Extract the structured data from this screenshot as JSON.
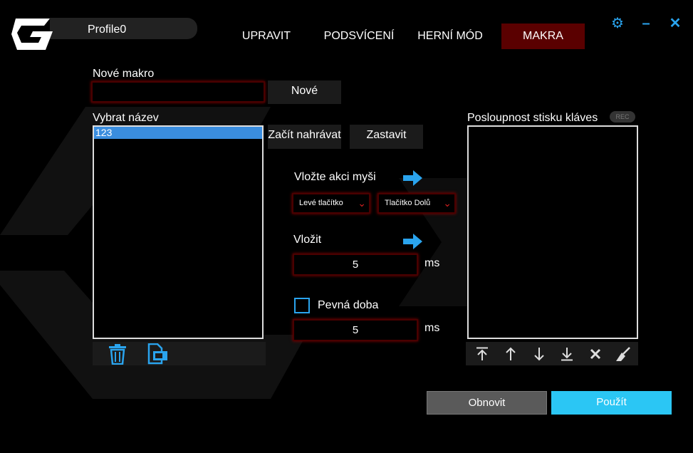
{
  "header": {
    "profile_name": "Profile0",
    "tabs": [
      {
        "label": "UPRAVIT",
        "active": false
      },
      {
        "label": "PODSVÍCENÍ",
        "active": false
      },
      {
        "label": "HERNÍ MÓD",
        "active": false
      },
      {
        "label": "MAKRA",
        "active": true
      }
    ],
    "window_controls": [
      "gear-icon",
      "minimize-icon",
      "close-icon"
    ]
  },
  "new_macro": {
    "label": "Nové makro",
    "input_value": "",
    "new_button": "Nové"
  },
  "macro_list": {
    "label": "Vybrat název",
    "items": [
      "123"
    ],
    "selected": "123",
    "toolbar_icons": [
      "trash-icon",
      "copy-icon"
    ]
  },
  "record": {
    "start_button": "Začít nahrávat",
    "stop_button": "Zastavit"
  },
  "mouse_action": {
    "label": "Vložte akci myši",
    "button_select": "Levé tlačítko",
    "direction_select": "Tlačítko Dolů"
  },
  "delay": {
    "label": "Vložit",
    "value": "5",
    "unit": "ms"
  },
  "fixed_time": {
    "label": "Pevná doba",
    "checked": false,
    "value": "5",
    "unit": "ms"
  },
  "sequence": {
    "label": "Posloupnost stisku kláves",
    "rec_badge": "REC",
    "toolbar_icons": [
      "move-top-icon",
      "move-up-icon",
      "move-down-icon",
      "move-bottom-icon",
      "delete-icon",
      "clear-icon"
    ]
  },
  "footer": {
    "refresh_button": "Obnovit",
    "apply_button": "Použít"
  },
  "colors": {
    "accent_blue": "#2aa4ee",
    "active_tab": "#5a0000",
    "apply_button": "#2bc6f4",
    "input_glow": "#8a0000"
  }
}
